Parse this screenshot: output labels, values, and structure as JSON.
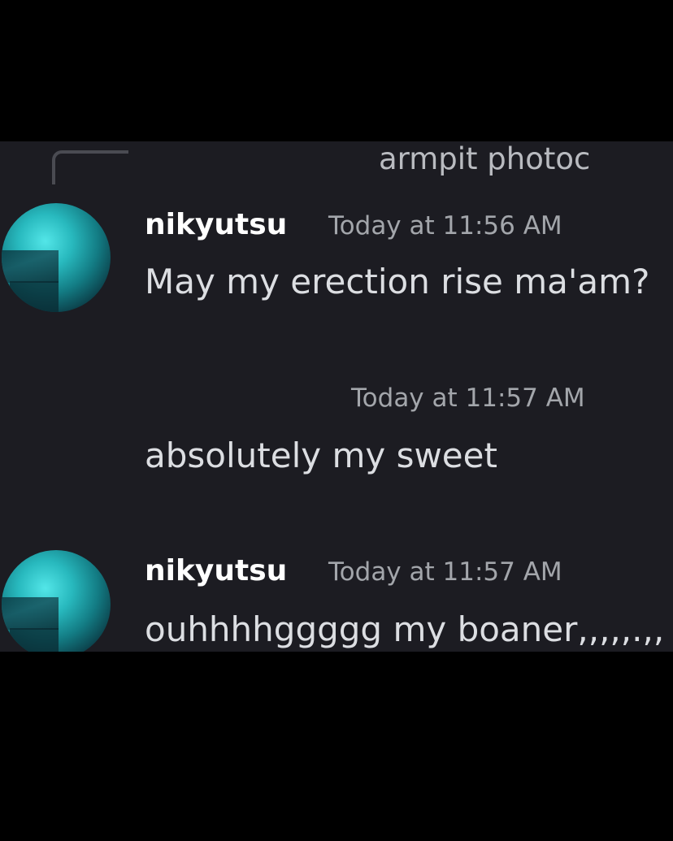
{
  "reply_preview": {
    "text": "armpit photoc"
  },
  "messages": [
    {
      "username": "nikyutsu",
      "timestamp": "Today at 11:56 AM",
      "text": "May my erection rise ma'am?"
    },
    {
      "timestamp": "Today at 11:57 AM",
      "text": "absolutely my sweet"
    },
    {
      "username": "nikyutsu",
      "timestamp": "Today at 11:57 AM",
      "text": "ouhhhhggggg my boaner,,,,,.,,"
    }
  ],
  "colors": {
    "background": "#000000",
    "panel": "#1c1c22",
    "username": "#ffffff",
    "timestamp": "#a3a6ab",
    "message": "#dcdee2",
    "avatar_accent": "#28b9be"
  },
  "icons": {
    "avatar": "user-avatar-teal-photo"
  }
}
